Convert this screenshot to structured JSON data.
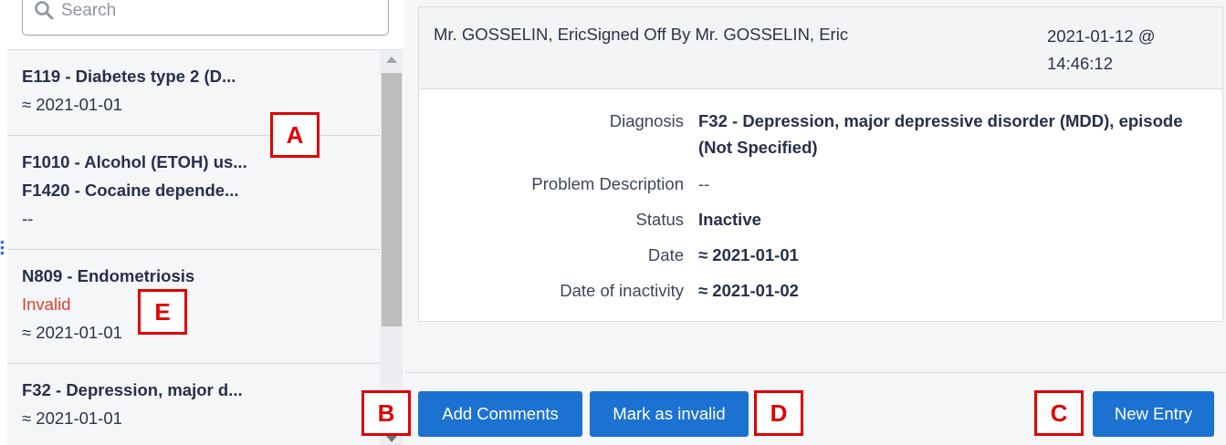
{
  "search": {
    "placeholder": "Search"
  },
  "problem_list": [
    {
      "lines": [
        "E119 - Diabetes type 2 (D..."
      ],
      "date": "≈ 2021-01-01"
    },
    {
      "lines": [
        "F1010 - Alcohol (ETOH) us...",
        "F1420 - Cocaine depende..."
      ],
      "date": "--"
    },
    {
      "lines": [
        "N809 - Endometriosis"
      ],
      "status": "Invalid",
      "date": "≈ 2021-01-01"
    },
    {
      "lines": [
        "F32 - Depression, major d..."
      ],
      "date": "≈ 2021-01-01"
    }
  ],
  "detail": {
    "author": "Mr. GOSSELIN, EricSigned Off By Mr. GOSSELIN, Eric",
    "datetime": "2021-01-12 @ 14:46:12",
    "fields": {
      "diagnosis_label": "Diagnosis",
      "diagnosis_value": "F32 - Depression, major depressive disorder (MDD), episode (Not Specified)",
      "problem_description_label": "Problem Description",
      "problem_description_value": "--",
      "status_label": "Status",
      "status_value": "Inactive",
      "date_label": "Date",
      "date_value": "≈ 2021-01-01",
      "date_inactivity_label": "Date of inactivity",
      "date_inactivity_value": "≈ 2021-01-02"
    }
  },
  "buttons": {
    "add_comments": "Add Comments",
    "mark_invalid": "Mark as invalid",
    "new_entry": "New Entry"
  },
  "callouts": {
    "a": "A",
    "b": "B",
    "c": "C",
    "d": "D",
    "e": "E"
  },
  "colors": {
    "primary": "#1b72d1",
    "invalid": "#e0412b",
    "callout": "#e00000"
  }
}
